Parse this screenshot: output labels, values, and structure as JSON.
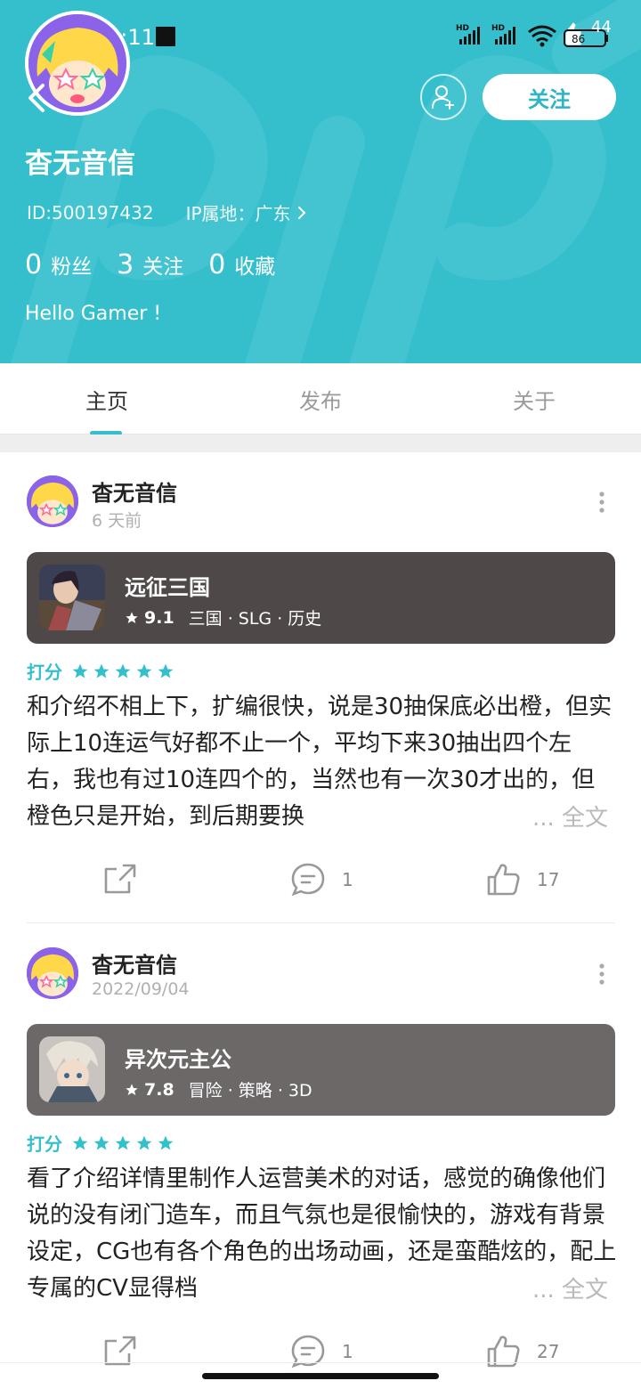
{
  "status_bar": {
    "time": "8:11",
    "battery": "86",
    "notification_count": "44"
  },
  "profile": {
    "name": "杳无音信",
    "id_text": "ID:500197432",
    "ip_text": "IP属地：广东",
    "stats": [
      {
        "num": "0",
        "label": "粉丝"
      },
      {
        "num": "3",
        "label": "关注"
      },
      {
        "num": "0",
        "label": "收藏"
      }
    ],
    "bio": "Hello Gamer !",
    "follow_label": "关注"
  },
  "tabs": [
    {
      "label": "主页"
    },
    {
      "label": "发布"
    },
    {
      "label": "关于"
    }
  ],
  "posts": [
    {
      "author": "杳无音信",
      "time": "6 天前",
      "game": {
        "name": "远征三国",
        "score": "9.1",
        "tags": "三国 · SLG · 历史",
        "color": "#4e4848"
      },
      "rating_label": "打分",
      "stars": 5,
      "text": "和介绍不相上下，扩编很快，说是30抽保底必出橙，但实际上10连运气好都不止一个，平均下来30抽出四个左右，我也有过10连四个的，当然也有一次30才出的，但橙色只是开始，到后期要换",
      "read_more": "... 全文",
      "comments": "1",
      "likes": "17"
    },
    {
      "author": "杳无音信",
      "time": "2022/09/04",
      "game": {
        "name": "异次元主公",
        "score": "7.8",
        "tags": "冒险 · 策略 · 3D",
        "color": "#6c6868"
      },
      "rating_label": "打分",
      "stars": 5,
      "text": "看了介绍详情里制作人运营美术的对话，感觉的确像他们说的没有闭门造车，而且气氛也是很愉快的，游戏有背景设定，CG也有各个角色的出场动画，还是蛮酷炫的，配上专属的CV显得档",
      "read_more": "... 全文",
      "comments": "1",
      "likes": "27"
    }
  ],
  "colors": {
    "accent": "#35bfcc",
    "header_bg": "#35bfcc"
  }
}
